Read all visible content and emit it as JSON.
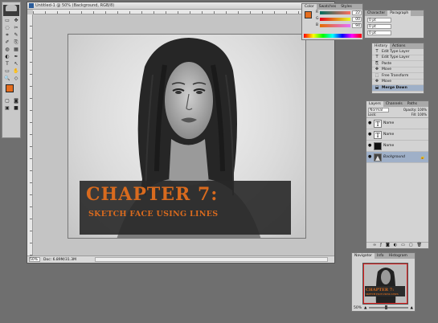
{
  "document": {
    "title": "Untitled-1 @ 50% (Background, RGB/8)",
    "zoom": "50%",
    "doc_info": "Doc: 6.89M/31.3M",
    "banner": {
      "chapter": "CHAPTER 7:",
      "subtitle": "SKETCH FACE USING LINES"
    }
  },
  "toolbox": {
    "tools": [
      "▭",
      "✥",
      "◌",
      "✂",
      "⌗",
      "✎",
      "✐",
      "⎘",
      "◍",
      "▦",
      "◐",
      "✒",
      "T",
      "↖",
      "▭",
      "✋",
      "🔍",
      "◇"
    ],
    "foreground_color": "#e56d1e",
    "background_color": "#ffffff"
  },
  "color_panel": {
    "tabs": [
      "Color",
      "Swatches",
      "Styles"
    ],
    "rows": [
      {
        "label": "R",
        "value": "22"
      },
      {
        "label": "G",
        "value": "00"
      },
      {
        "label": "B",
        "value": "94"
      }
    ],
    "swatch": "#e56d1e"
  },
  "char_panel": {
    "tabs": [
      "Character",
      "Paragraph"
    ],
    "fields": [
      "0 pt",
      "0 pt",
      "0 pt"
    ]
  },
  "history_panel": {
    "tabs": [
      "History",
      "Actions"
    ],
    "items": [
      {
        "label": "Edit Type Layer",
        "icon": "T"
      },
      {
        "label": "Edit Type Layer",
        "icon": "T"
      },
      {
        "label": "Paste",
        "icon": "⎘"
      },
      {
        "label": "Move",
        "icon": "✥"
      },
      {
        "label": "Free Transform",
        "icon": "⬚"
      },
      {
        "label": "Move",
        "icon": "✥"
      },
      {
        "label": "Merge Down",
        "icon": "⬓"
      }
    ],
    "active_index": 6
  },
  "layers_panel": {
    "tabs": [
      "Layers",
      "Channels",
      "Paths"
    ],
    "blend": "Normal",
    "opacity": "Opacity: 100%",
    "lock": "Lock:",
    "fill": "Fill: 100%",
    "layers": [
      {
        "name": "Name",
        "thumb": "T"
      },
      {
        "name": "Name",
        "thumb": "T"
      },
      {
        "name": "Name",
        "thumb": ""
      },
      {
        "name": "Background",
        "thumb": "▲"
      }
    ]
  },
  "navigator_panel": {
    "tabs": [
      "Navigator",
      "Info",
      "Histogram"
    ],
    "zoom": "50%",
    "thumb_chapter": "CHAPTER 7:",
    "thumb_subtitle": "SKETCH FACE USING LINES"
  }
}
